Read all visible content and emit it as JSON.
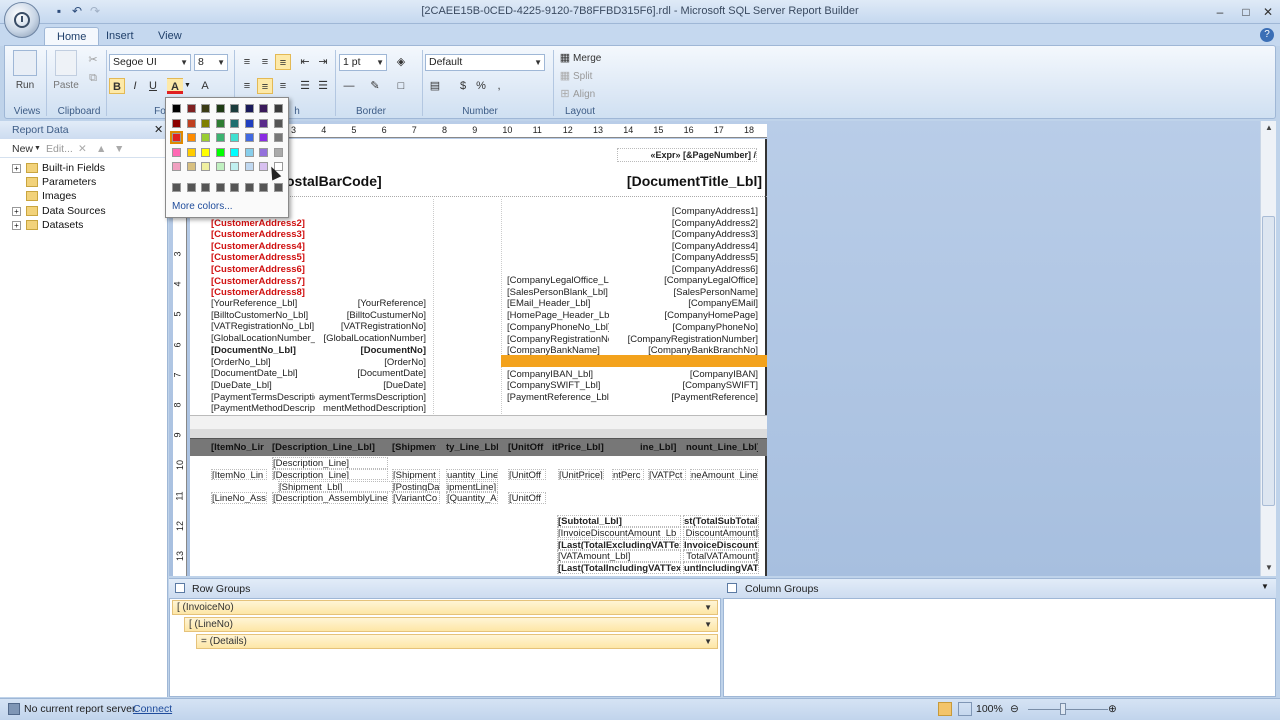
{
  "titlebar": {
    "title": "[2CAEE15B-0CED-4225-9120-7B8FFBD315F6].rdl - Microsoft SQL Server Report Builder",
    "min": "–",
    "max": "□",
    "close": "✕"
  },
  "tabs": [
    {
      "label": "Home",
      "active": true
    },
    {
      "label": "Insert",
      "active": false
    },
    {
      "label": "View",
      "active": false
    }
  ],
  "ribbon": {
    "run_label": "Run",
    "paste_label": "Paste",
    "views_label": "Views",
    "clipboard_label": "Clipboard",
    "font_label": "Fo",
    "paragraph_label": "h",
    "border_label": "Border",
    "number_label": "Number",
    "layout_label": "Layout",
    "font_name": "Segoe UI",
    "font_size": "8",
    "border_width": "1 pt",
    "number_format": "Default",
    "merge_label": "Merge",
    "split_label": "Split",
    "align_label": "Align",
    "bold": "B",
    "italic": "I",
    "underline": "U",
    "font_color_glyph": "A",
    "grow_font": "A",
    "dollar": "$",
    "percent": "%"
  },
  "report_data": {
    "title": "Report Data",
    "new_label": "New",
    "edit_label": "Edit...",
    "tree": [
      {
        "label": "Built-in Fields",
        "expandable": true
      },
      {
        "label": "Parameters",
        "expandable": false
      },
      {
        "label": "Images",
        "expandable": false
      },
      {
        "label": "Data Sources",
        "expandable": true
      },
      {
        "label": "Datasets",
        "expandable": true
      }
    ]
  },
  "ruler": {
    "h": [
      "3",
      "4",
      "5",
      "6",
      "7",
      "8",
      "9",
      "10",
      "11",
      "12",
      "13",
      "14",
      "15",
      "16",
      "17",
      "18"
    ],
    "v": [
      "3",
      "4",
      "5",
      "6",
      "7",
      "8",
      "9",
      "10",
      "11",
      "12",
      "13"
    ]
  },
  "report": {
    "page_number": "«Expr» [&PageNumber] /",
    "postal_barcode": "ostalBarCode]",
    "document_title": "[DocumentTitle_Lbl]",
    "customer_address": [
      "1]",
      "[CustomerAddress2]",
      "[CustomerAddress3]",
      "[CustomerAddress4]",
      "[CustomerAddress5]",
      "[CustomerAddress6]",
      "[CustomerAddress7]",
      "[CustomerAddress8]"
    ],
    "company_address": [
      "[CompanyAddress1]",
      "[CompanyAddress2]",
      "[CompanyAddress3]",
      "[CompanyAddress4]",
      "[CompanyAddress5]",
      "[CompanyAddress6]"
    ],
    "left_rows": [
      {
        "label": "[YourReference_Lbl]",
        "value": "[YourReference]",
        "bold": false
      },
      {
        "label": "[BilltoCustomerNo_Lbl]",
        "value": "[BilltoCustumerNo]",
        "bold": false
      },
      {
        "label": "[VATRegistrationNo_Lbl]",
        "value": "[VATRegistrationNo]",
        "bold": false
      },
      {
        "label": "[GlobalLocationNumber_",
        "value": "[GlobalLocationNumber]",
        "bold": false
      },
      {
        "label": "[DocumentNo_Lbl]",
        "value": "[DocumentNo]",
        "bold": true
      },
      {
        "label": "[OrderNo_Lbl]",
        "value": "[OrderNo]",
        "bold": false
      },
      {
        "label": "[DocumentDate_Lbl]",
        "value": "[DocumentDate]",
        "bold": false
      },
      {
        "label": "[DueDate_Lbl]",
        "value": "[DueDate]",
        "bold": false
      },
      {
        "label": "[PaymentTermsDescriptio",
        "value": "aymentTermsDescription]",
        "bold": false
      },
      {
        "label": "[PaymentMethodDescrip",
        "value": "mentMethodDescription]",
        "bold": false
      }
    ],
    "right_rows": [
      {
        "label": "[CompanyLegalOffice_Lb",
        "value": "[CompanyLegalOffice]"
      },
      {
        "label": "[SalesPersonBlank_Lbl]",
        "value": "[SalesPersonName]"
      },
      {
        "label": "[EMail_Header_Lbl]",
        "value": "[CompanyEMail]"
      },
      {
        "label": "[HomePage_Header_Lbl]",
        "value": "[CompanyHomePage]"
      },
      {
        "label": "[CompanyPhoneNo_Lbl]",
        "value": "[CompanyPhoneNo]"
      },
      {
        "label": "[CompanyRegistrationNo",
        "value": "[CompanyRegistrationNumber]"
      },
      {
        "label": "[CompanyBankName]",
        "value": "[CompanyBankBranchNo]"
      },
      {
        "label": "",
        "value": ""
      },
      {
        "label": "[CompanyIBAN_Lbl]",
        "value": "[CompanyIBAN]"
      },
      {
        "label": "[CompanySWIFT_Lbl]",
        "value": "[CompanySWIFT]"
      },
      {
        "label": "[PaymentReference_Lbl]",
        "value": "[PaymentReference]"
      }
    ],
    "lines_header": [
      "[ItemNo_Lir",
      "[Description_Line_Lbl]",
      "[Shipment",
      "ty_Line_Lbl]",
      "[UnitOff",
      "itPrice_Lbl]",
      "ine_Lbl]",
      "nount_Line_Lbl]"
    ],
    "line_rows": [
      [
        "",
        "[Description_Line]",
        "",
        "",
        "",
        "",
        "",
        ""
      ],
      [
        "[ItemNo_Lin",
        "[Description_Line]",
        "[Shipment",
        "uantity_Line]",
        "[UnitOff",
        "[UnitPrice]",
        "ntPerc",
        "[VATPct_",
        "neAmount_Line]"
      ],
      [
        "",
        "[Shipment_Lbl]",
        "[PostingDa",
        "ipmentLine]",
        "",
        "",
        "",
        "",
        ""
      ],
      [
        "[LineNo_Ass",
        "[Description_AssemblyLine]",
        "[VariantCo",
        "[Quantity_A:",
        "[UnitOff",
        "",
        "",
        "",
        ""
      ]
    ],
    "totals": [
      {
        "label": "[Subtotal_Lbl]",
        "value": "st(TotalSubTotal)",
        "bold": true
      },
      {
        "label": "[InvoiceDiscountAmount_Lb",
        "value": "DiscountAmount]",
        "bold": false
      },
      {
        "label": "[Last(TotalExcludingVATText",
        "value": "InvoiceDiscount]",
        "bold": true
      },
      {
        "label": "[VATAmount_Lbl]",
        "value": "TotalVATAmount]",
        "bold": false
      },
      {
        "label": "[Last(TotalIncludingVATText",
        "value": "untIncludingVAT]",
        "bold": true
      }
    ]
  },
  "groups": {
    "row_title": "Row Groups",
    "col_title": "Column Groups",
    "rows": [
      "[ (InvoiceNo)",
      "[ (LineNo)",
      "= (Details)"
    ]
  },
  "status": {
    "server_text": "No current report server.",
    "connect": "Connect",
    "zoom": "100%"
  },
  "color_popup": {
    "more_colors": "More colors...",
    "selected": "#e02020"
  }
}
